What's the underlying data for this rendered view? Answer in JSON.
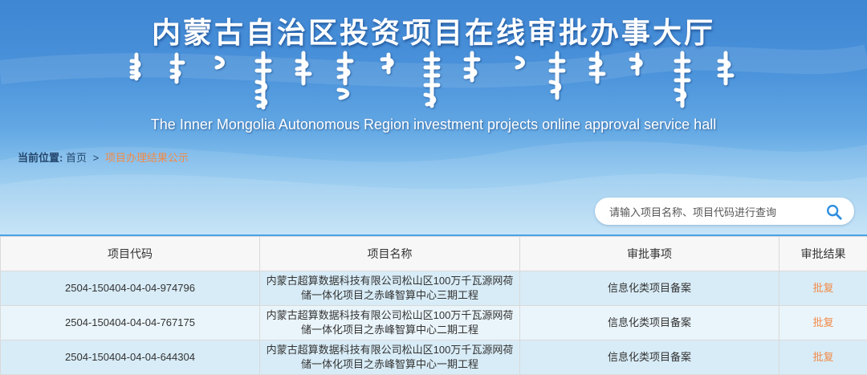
{
  "header": {
    "title_cn": "内蒙古自治区投资项目在线审批办事大厅",
    "title_en": "The Inner Mongolia Autonomous Region investment projects online approval service hall",
    "title_mongolian": "ᠥᠪᠥᠷ ᠮᠣᠩᠭᠣᠯ ᠤᠨ ᠥᠪᠡᠷᠲᠡᠭᠡᠨ ᠵᠠᠰᠠᠬᠤ ᠣᠷᠣᠨ"
  },
  "breadcrumb": {
    "label": "当前位置:",
    "home": "首页",
    "separator": ">",
    "current": "项目办理结果公示"
  },
  "search": {
    "placeholder": "请输入项目名称、项目代码进行查询",
    "icon": "search-icon"
  },
  "table": {
    "columns": [
      "项目代码",
      "项目名称",
      "审批事项",
      "审批结果"
    ],
    "rows": [
      {
        "code": "2504-150404-04-04-974796",
        "name": "内蒙古超算数据科技有限公司松山区100万千瓦源网荷储一体化项目之赤峰智算中心三期工程",
        "matter": "信息化类项目备案",
        "result": "批复"
      },
      {
        "code": "2504-150404-04-04-767175",
        "name": "内蒙古超算数据科技有限公司松山区100万千瓦源网荷储一体化项目之赤峰智算中心二期工程",
        "matter": "信息化类项目备案",
        "result": "批复"
      },
      {
        "code": "2504-150404-04-04-644304",
        "name": "内蒙古超算数据科技有限公司松山区100万千瓦源网荷储一体化项目之赤峰智算中心一期工程",
        "matter": "信息化类项目备案",
        "result": "批复"
      }
    ]
  },
  "colors": {
    "banner_top": "#3f86d3",
    "banner_bottom": "#b9def5",
    "accent_link": "#f28a47",
    "row_a": "#d8ecf7",
    "row_b": "#eaf5fb"
  }
}
